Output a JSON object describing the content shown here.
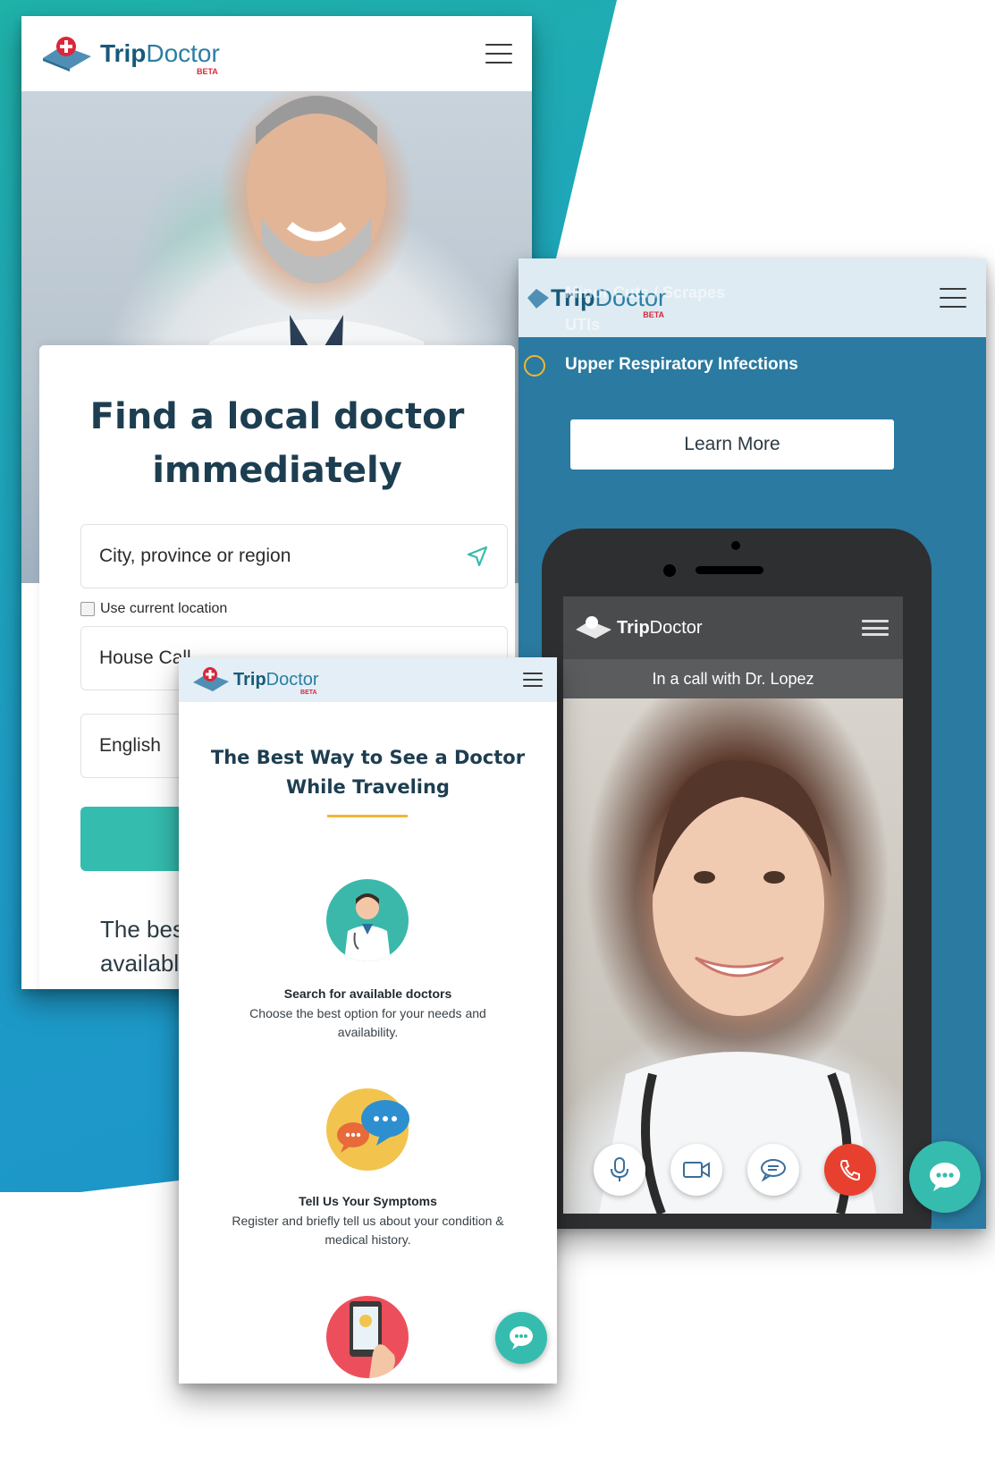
{
  "brand": {
    "name_part1": "Trip",
    "name_part2": "Doctor",
    "beta": "BETA",
    "colors": {
      "teal": "#34bcae",
      "navy": "#1d3e50",
      "blue": "#2a7aa1",
      "accent_yellow": "#f2b632",
      "end_call_red": "#e8402f"
    }
  },
  "screen_search": {
    "title_line1": "Find a local doctor",
    "title_line2": "immediately",
    "location_placeholder": "City, province or region",
    "location_icon": "navigation-arrow-icon",
    "use_current_location": "Use current location",
    "visit_type": "House Call",
    "language": "English",
    "teaser_line1": "The best l",
    "teaser_line2": "available t"
  },
  "screen_video": {
    "ghost_item1": "Minor Cuts / Scrapes",
    "ghost_item2": "UTIs",
    "condition": "Upper Respiratory Infections",
    "learn_more": "Learn More",
    "call_status": "In a call with Dr. Lopez",
    "controls": [
      "microphone-icon",
      "video-camera-icon",
      "chat-bubble-icon",
      "end-call-icon"
    ]
  },
  "screen_how": {
    "title_line1": "The Best Way to See a Doctor",
    "title_line2": "While Traveling",
    "features": [
      {
        "title": "Search for available doctors",
        "desc_line1": "Choose the best option for your needs and",
        "desc_line2": "availability.",
        "icon": "doctor-avatar-icon"
      },
      {
        "title": "Tell Us Your Symptoms",
        "desc_line1": "Register and briefly tell us about your condition &",
        "desc_line2": "medical history.",
        "icon": "speech-bubbles-icon"
      },
      {
        "title": "",
        "icon": "phone-tap-icon"
      }
    ]
  },
  "chat_fab_icon": "chat-dots-icon"
}
